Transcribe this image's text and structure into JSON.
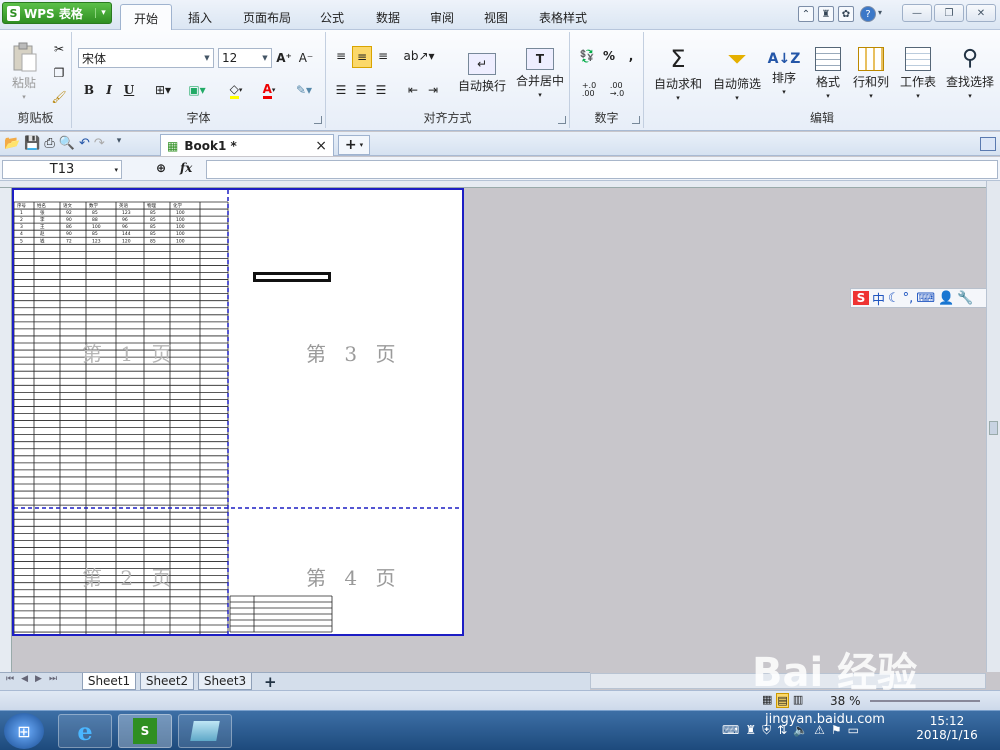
{
  "app": {
    "button_label": "WPS 表格",
    "logo_glyph": "S"
  },
  "tabs": [
    "开始",
    "插入",
    "页面布局",
    "公式",
    "数据",
    "审阅",
    "视图",
    "表格样式"
  ],
  "active_tab": "开始",
  "ribbon": {
    "clipboard": {
      "label": "剪贴板",
      "paste": "粘贴"
    },
    "font": {
      "label": "字体",
      "font_name": "宋体",
      "font_size": "12",
      "bold": "B",
      "italic": "I",
      "underline": "U",
      "grow": "A⁺",
      "shrink": "A⁻"
    },
    "alignment": {
      "label": "对齐方式",
      "wrap": "自动换行",
      "merge": "合并居中"
    },
    "number": {
      "label": "数字",
      "percent": "%",
      "comma": ","
    },
    "editing": {
      "label": "编辑",
      "autosum": "自动求和",
      "autofilter": "自动筛选",
      "sort": "排序",
      "format": "格式",
      "rowcol": "行和列",
      "worksheet": "工作表",
      "find": "查找选择"
    }
  },
  "document_tab": {
    "title": "Book1 *",
    "close": "×",
    "add": "+"
  },
  "formula_bar": {
    "cell_ref": "T13",
    "fx": "fx",
    "value": ""
  },
  "sheet": {
    "pages": [
      "第 1 页",
      "第 2 页",
      "第 3 页",
      "第 4 页"
    ],
    "mini_headers": [
      "序号",
      "姓名",
      "语文",
      "数学",
      "英语",
      "物理",
      "化学"
    ],
    "mini_rows": [
      [
        "1",
        "张",
        "92",
        "85",
        "123",
        "85",
        "100"
      ],
      [
        "2",
        "李",
        "90",
        "88",
        "96",
        "85",
        "100"
      ],
      [
        "3",
        "王",
        "86",
        "100",
        "96",
        "85",
        "100"
      ],
      [
        "4",
        "赵",
        "90",
        "85",
        "144",
        "85",
        "100"
      ],
      [
        "5",
        "钱",
        "72",
        "123",
        "120",
        "85",
        "100"
      ]
    ]
  },
  "sheet_tabs": [
    "Sheet1",
    "Sheet2",
    "Sheet3"
  ],
  "active_sheet": "Sheet1",
  "status": {
    "zoom": "38 %"
  },
  "ime": {
    "text": "中"
  },
  "taskbar": {
    "time": "15:12",
    "date": "2018/1/16"
  },
  "watermark": {
    "text": "Bai 经验",
    "url": "jingyan.baidu.com"
  },
  "colors": {
    "accent_green": "#2f8f22",
    "page_border": "#1d1ec4",
    "ribbon_bg": "#e7eef8"
  }
}
